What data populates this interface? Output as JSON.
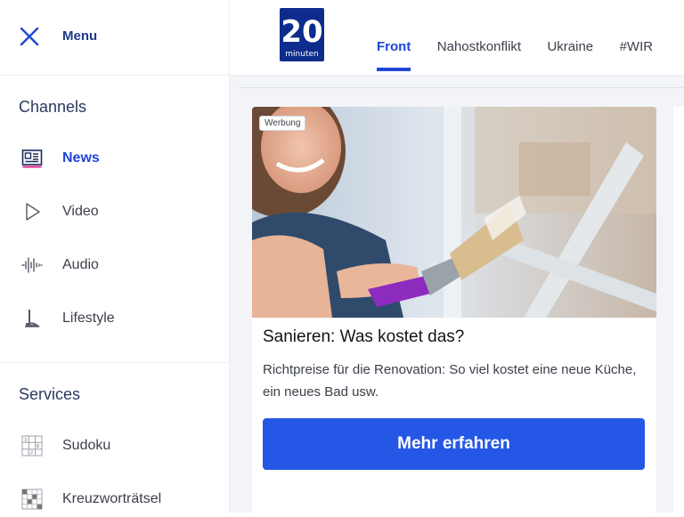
{
  "sidebar": {
    "menu_label": "Menu",
    "channels_title": "Channels",
    "services_title": "Services",
    "channels": [
      {
        "label": "News",
        "icon": "newspaper-icon",
        "active": true
      },
      {
        "label": "Video",
        "icon": "play-icon",
        "active": false
      },
      {
        "label": "Audio",
        "icon": "waveform-icon",
        "active": false
      },
      {
        "label": "Lifestyle",
        "icon": "heel-icon",
        "active": false
      }
    ],
    "services": [
      {
        "label": "Sudoku",
        "icon": "sudoku-grid-icon"
      },
      {
        "label": "Kreuzworträtsel",
        "icon": "crossword-grid-icon"
      }
    ]
  },
  "header": {
    "logo_text_top": "20",
    "logo_text_bottom": "minuten",
    "tabs": [
      "Front",
      "Nahostkonflikt",
      "Ukraine",
      "#WIR"
    ],
    "active_tab": "Front"
  },
  "ad": {
    "badge": "Werbung",
    "title": "Sanieren: Was kostet das?",
    "text": "Richtpreise für die Renovation: So viel kostet eine neue Küche, ein neues Bad usw.",
    "cta": "Mehr erfahren"
  },
  "colors": {
    "accent": "#2046d9",
    "cta": "#2557e6",
    "content_bg": "#f3f4f7",
    "logo_bg": "#0d2c8c"
  }
}
